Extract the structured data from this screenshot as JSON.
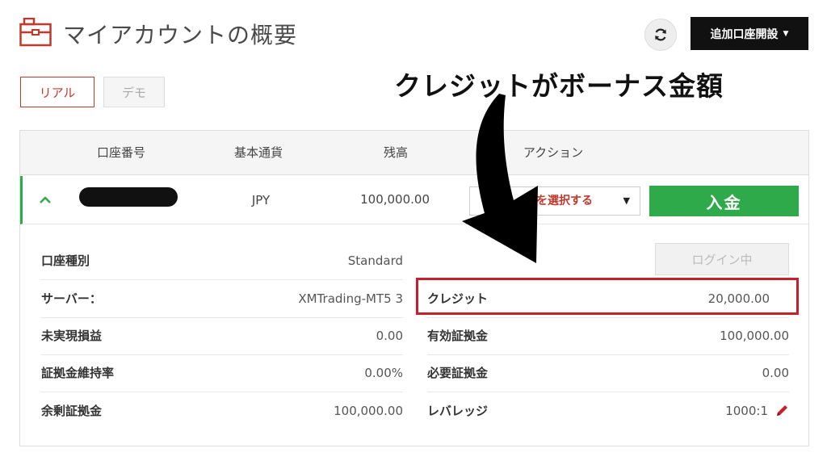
{
  "header": {
    "title": "マイアカウントの概要",
    "open_account_label": "追加口座開設"
  },
  "tabs": [
    {
      "label": "リアル",
      "active": true
    },
    {
      "label": "デモ",
      "active": false
    }
  ],
  "annotation": {
    "text": "クレジットがボーナス金額"
  },
  "table": {
    "headers": {
      "account_number": "口座番号",
      "base_currency": "基本通貨",
      "balance": "残高",
      "action": "アクション"
    },
    "row": {
      "currency": "JPY",
      "balance": "100,000.00",
      "action_select": "ンを選択する",
      "deposit_label": "入金"
    }
  },
  "details": {
    "left": [
      {
        "label": "口座種別",
        "value": "Standard"
      },
      {
        "label": "サーバー：",
        "value": "XMTrading-MT5 3"
      },
      {
        "label": "未実現損益",
        "value": "0.00"
      },
      {
        "label": "証拠金維持率",
        "value": "0.00%"
      },
      {
        "label": "余剰証拠金",
        "value": "100,000.00"
      }
    ],
    "right": [
      {
        "label": "クレジット",
        "value": "20,000.00"
      },
      {
        "label": "有効証拠金",
        "value": "100,000.00"
      },
      {
        "label": "必要証拠金",
        "value": "0.00"
      },
      {
        "label": "レバレッジ",
        "value": "1000:1"
      }
    ],
    "login_label": "ログイン中"
  },
  "colors": {
    "accent_red": "#c0392b",
    "deposit_green": "#2eaa4a",
    "highlight_red": "#c8202a"
  },
  "icons": {
    "header": "briefcase-icon",
    "refresh": "refresh-icon",
    "expand": "chevron-up-icon",
    "edit_leverage": "pencil-icon"
  }
}
